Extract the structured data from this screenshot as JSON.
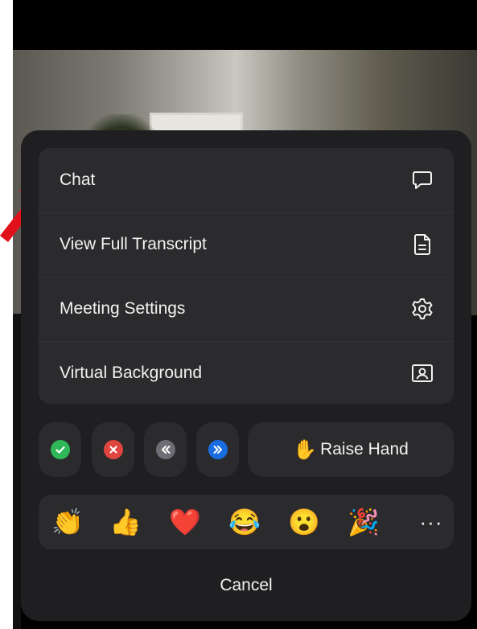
{
  "menu": {
    "items": [
      {
        "label": "Chat",
        "icon": "chat-bubble-icon"
      },
      {
        "label": "View Full Transcript",
        "icon": "transcript-document-icon"
      },
      {
        "label": "Meeting Settings",
        "icon": "gear-icon"
      },
      {
        "label": "Virtual Background",
        "icon": "virtual-background-icon"
      }
    ]
  },
  "actions": {
    "buttons": [
      {
        "name": "yes",
        "icon": "check-icon",
        "color": "#2fb85a"
      },
      {
        "name": "no",
        "icon": "x-icon",
        "color": "#e0443e"
      },
      {
        "name": "slower",
        "icon": "rewind-icon",
        "color": "#6d6d75"
      },
      {
        "name": "faster",
        "icon": "fast-forward-icon",
        "color": "#1a6de0"
      }
    ],
    "raise_hand": {
      "emoji": "✋",
      "label": "Raise Hand"
    }
  },
  "reactions": {
    "emojis": [
      "👏",
      "👍",
      "❤️",
      "😂",
      "😮",
      "🎉"
    ],
    "more_label": "···"
  },
  "cancel_label": "Cancel",
  "colors": {
    "panel": "#1f1f21",
    "card": "#2b2b2d",
    "text": "#f2f2f2",
    "arrow": "#e0111b"
  }
}
